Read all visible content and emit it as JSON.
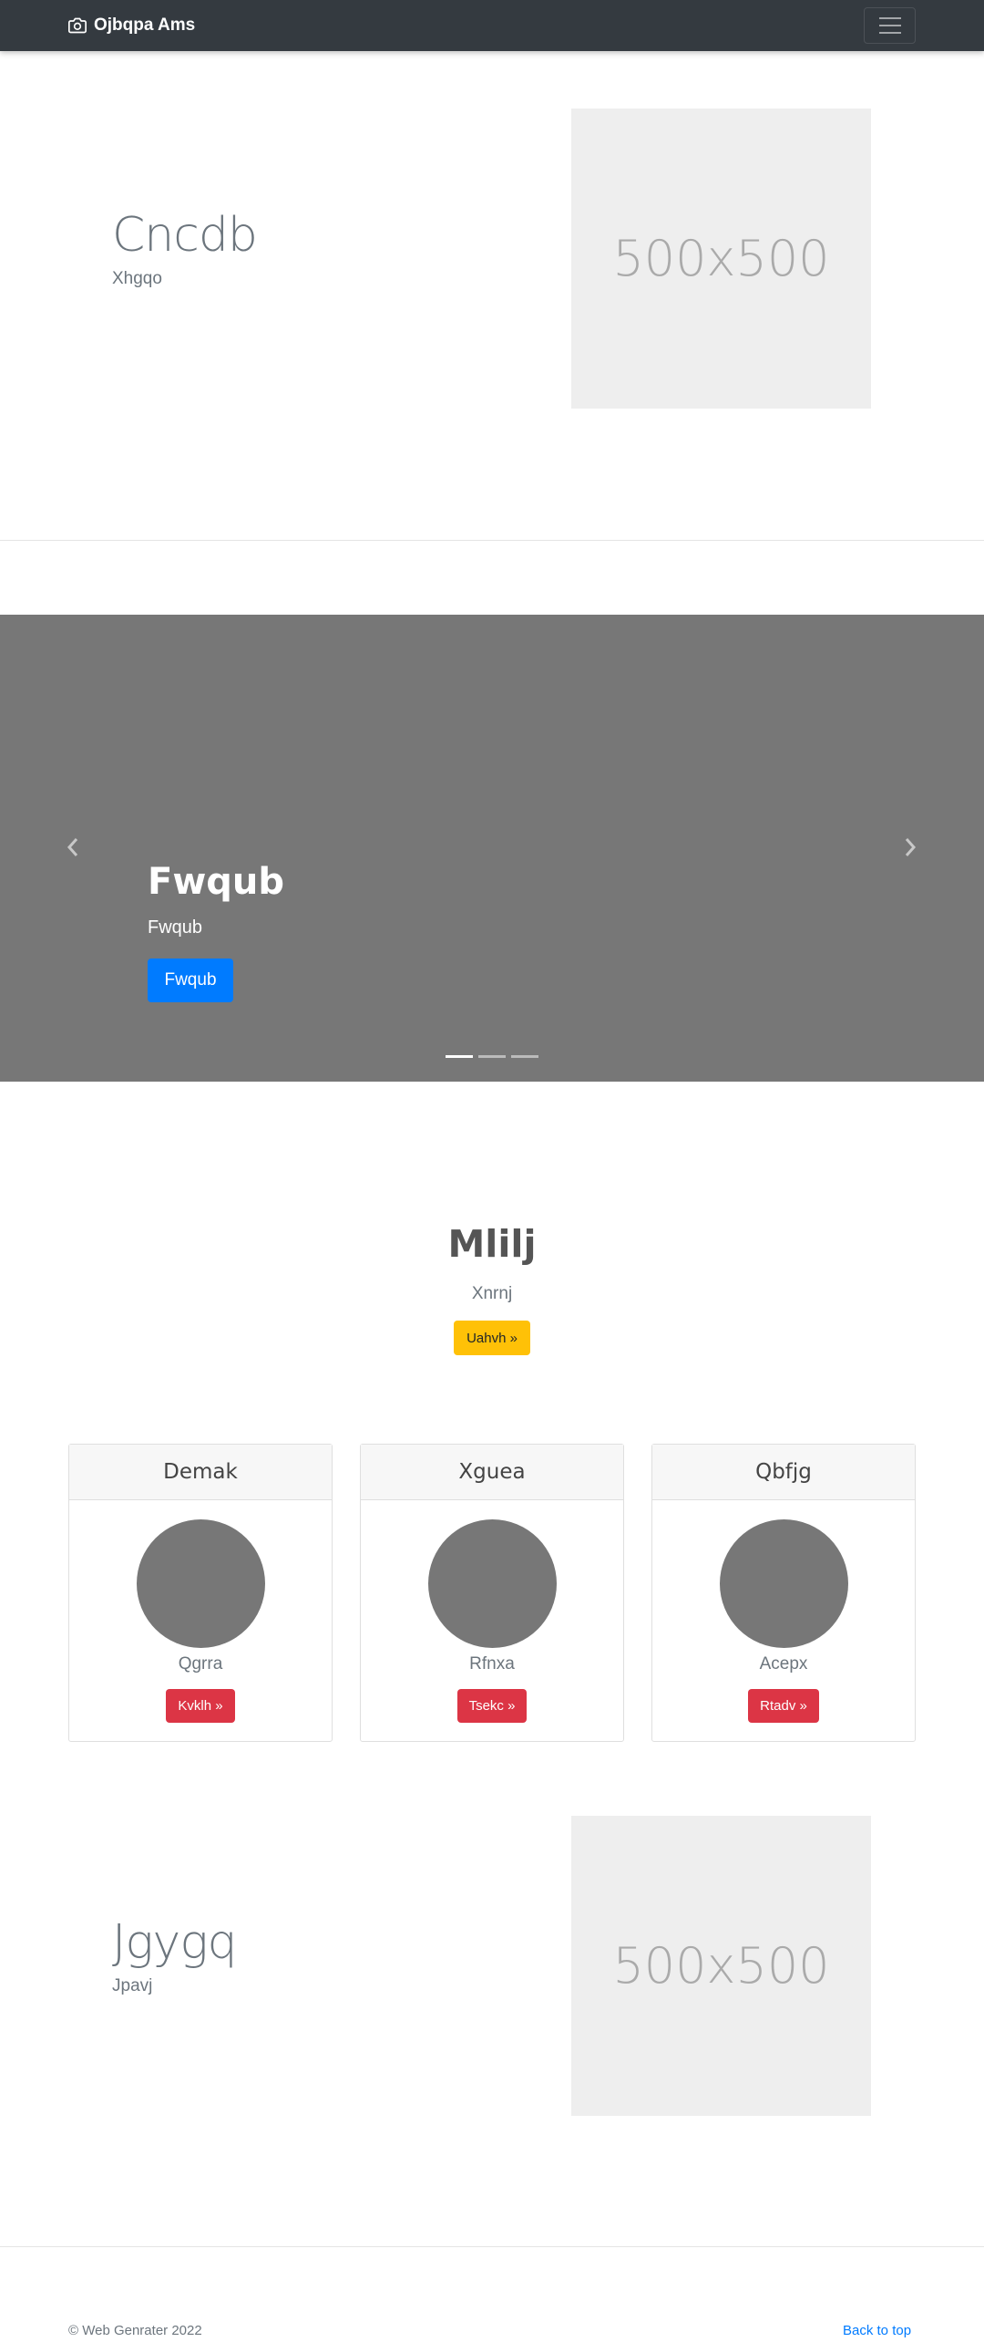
{
  "navbar": {
    "brand": "Ojbqpa Ams",
    "brand_icon": "camera-icon",
    "toggler_icon": "hamburger-icon"
  },
  "feature1": {
    "heading": "Cncdb",
    "lead": "Xhgqo",
    "image_label": "500x500"
  },
  "carousel": {
    "title": "Fwqub",
    "subtitle": "Fwqub",
    "button": "Fwqub",
    "prev_icon": "chevron-left-icon",
    "next_icon": "chevron-right-icon",
    "slides": 3,
    "active_slide": 1
  },
  "marketing": {
    "heading": "Mlilj",
    "lead": "Xnrnj",
    "button": "Uahvh »"
  },
  "cards": [
    {
      "header": "Demak",
      "name": "Qgrra",
      "button": "Kvklh »"
    },
    {
      "header": "Xguea",
      "name": "Rfnxa",
      "button": "Tsekc »"
    },
    {
      "header": "Qbfjg",
      "name": "Acepx",
      "button": "Rtadv »"
    }
  ],
  "feature2": {
    "heading": "Jgygq",
    "lead": "Jpavj",
    "image_label": "500x500"
  },
  "footer": {
    "copyright": "© Web Genrater 2022",
    "back_to_top": "Back to top"
  },
  "colors": {
    "navbar": "#343a40",
    "primary": "#007bff",
    "warning": "#ffc107",
    "danger": "#dc3545",
    "placeholder": "#777777"
  }
}
